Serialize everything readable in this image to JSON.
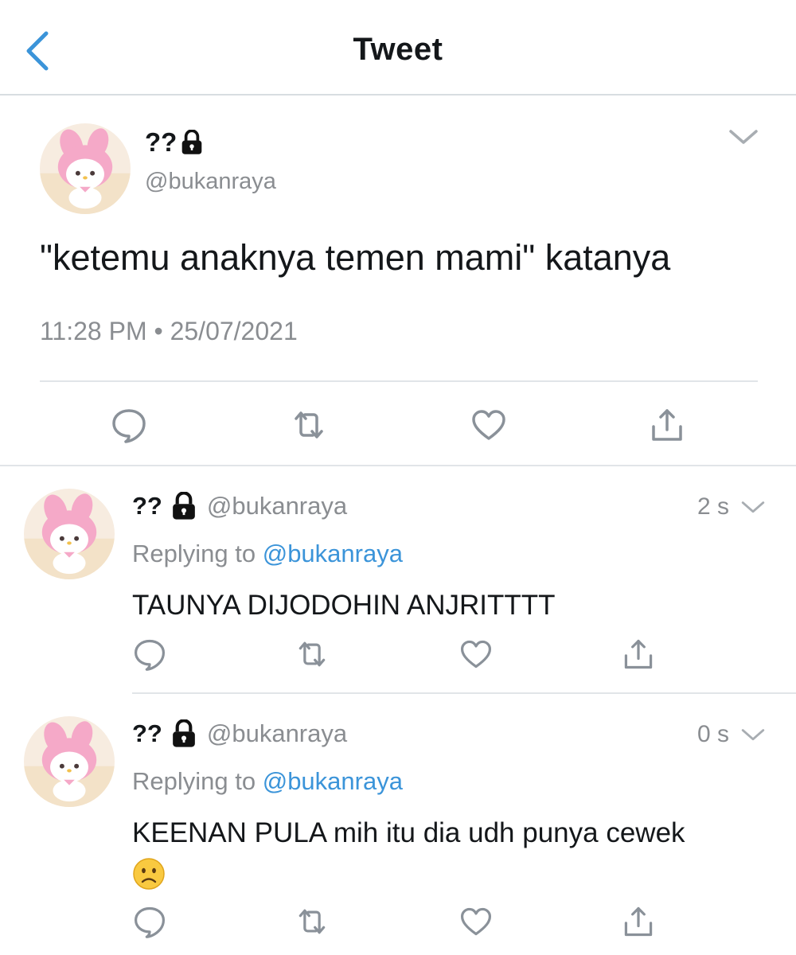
{
  "header": {
    "title": "Tweet",
    "back_icon": "chevron-left-icon"
  },
  "colors": {
    "link": "#3b94d9",
    "secondary_text": "#8a8d91",
    "avatar_pink": "#f5a9c8"
  },
  "main_tweet": {
    "name": "??",
    "handle": "@bukanraya",
    "text": "\"ketemu anaknya temen mami\" katanya",
    "timestamp": "11:28 PM • 25/07/2021",
    "actions": [
      "reply-icon",
      "retweet-icon",
      "like-icon",
      "share-icon"
    ]
  },
  "replies": [
    {
      "name": "??",
      "handle": "@bukanraya",
      "time": "2 s",
      "replying_prefix": "Replying to",
      "replying_to": "@bukanraya",
      "text": "TAUNYA DIJODOHIN ANJRITTTT"
    },
    {
      "name": "??",
      "handle": "@bukanraya",
      "time": "0 s",
      "replying_prefix": "Replying to",
      "replying_to": "@bukanraya",
      "text": "KEENAN PULA mih itu dia udh punya cewek",
      "emoji": "frowning-face-icon"
    }
  ]
}
